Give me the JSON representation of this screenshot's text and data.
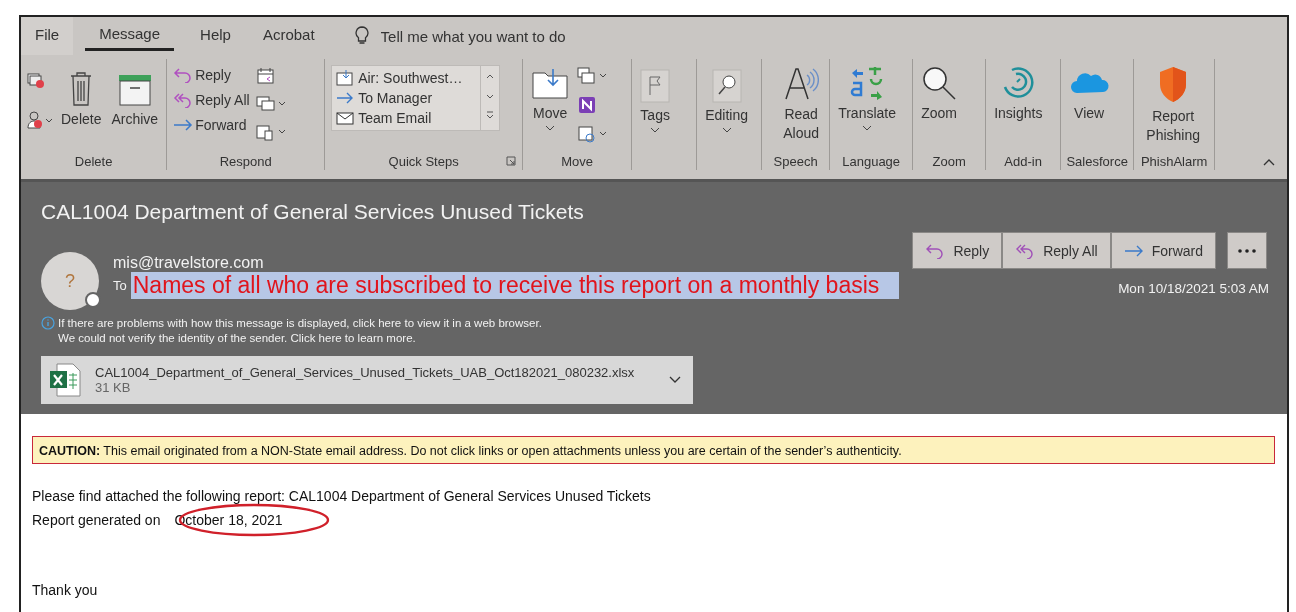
{
  "menu_tabs": [
    {
      "label": "File",
      "selected": false
    },
    {
      "label": "Message",
      "selected": true
    },
    {
      "label": "Help",
      "selected": false
    },
    {
      "label": "Acrobat",
      "selected": false
    }
  ],
  "tell_me": {
    "placeholder": "Tell me what you want to do"
  },
  "ribbon_groups": [
    {
      "kind": "delete",
      "label": "Delete",
      "items": [
        "Delete",
        "Archive"
      ]
    },
    {
      "kind": "respond",
      "label": "Respond",
      "items": [
        "Reply",
        "Reply All",
        "Forward"
      ]
    },
    {
      "kind": "quick_steps",
      "label": "Quick Steps",
      "items": [
        "Air: Southwest…",
        "To Manager",
        "Team Email"
      ]
    },
    {
      "kind": "move",
      "label": "Move",
      "items": [
        "Move"
      ]
    },
    {
      "kind": "tags",
      "items": [
        "Tags"
      ]
    },
    {
      "kind": "editing",
      "items": [
        "Editing"
      ]
    },
    {
      "kind": "speech",
      "label": "Speech",
      "items": [
        "Read Aloud"
      ]
    },
    {
      "kind": "language",
      "label": "Language",
      "items": [
        "Translate"
      ]
    },
    {
      "kind": "zoom",
      "label": "Zoom",
      "items": [
        "Zoom"
      ]
    },
    {
      "kind": "addin",
      "label": "Add-in",
      "items": [
        "Insights"
      ]
    },
    {
      "kind": "salesforce",
      "label": "Salesforce",
      "items": [
        "View"
      ]
    },
    {
      "kind": "phish",
      "label": "PhishAlarm",
      "items": [
        "Report Phishing"
      ]
    }
  ],
  "message": {
    "subject": "CAL1004 Department of General Services Unused Tickets",
    "avatar_mark": "?",
    "sender": "mis@travelstore.com",
    "to_label": "To",
    "recipients_note": "Names of all who are subscribed to receive this report on a monthly basis",
    "info_lines": [
      "If there are problems with how this message is displayed, click here to view it in a web browser.",
      "We could not verify the identity of the sender. Click here to learn more."
    ],
    "actions": [
      "Reply",
      "Reply All",
      "Forward"
    ],
    "date": "Mon 10/18/2021 5:03 AM",
    "attachment": {
      "name": "CAL1004_Department_of_General_Services_Unused_Tickets_UAB_Oct182021_080232.xlsx",
      "size": "31 KB"
    }
  },
  "body": {
    "caution": "**CAUTION:** This email originated from a NON-State email address. Do not click links or open attachments unless you are certain of the sender’s authenticity.",
    "intro": "Please find attached the following report: CAL1004 Department of General Services Unused Tickets",
    "generated_label": "Report generated on",
    "generated_date": "October 18, 2021",
    "closing": "Thank you"
  }
}
